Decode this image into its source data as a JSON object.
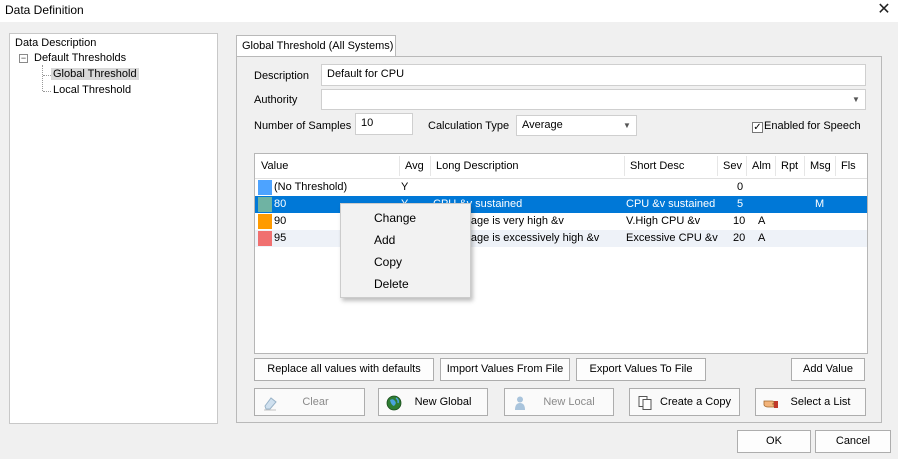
{
  "window": {
    "title": "Data Definition",
    "close_glyph": "✕"
  },
  "tree": {
    "root": "Data Description",
    "group": "Default Thresholds",
    "expander": "−",
    "items": [
      "Global Threshold",
      "Local Threshold"
    ]
  },
  "tab": {
    "label": "Global Threshold (All Systems)"
  },
  "form": {
    "description_label": "Description",
    "description_value": "Default for CPU",
    "authority_label": "Authority",
    "authority_value": "",
    "samples_label": "Number of Samples",
    "samples_value": "10",
    "calc_label": "Calculation Type",
    "calc_value": "Average",
    "speech_label": "Enabled for Speech",
    "speech_checked": true,
    "check_glyph": "✓",
    "dropdown_glyph": "▼"
  },
  "grid": {
    "columns": [
      "Value",
      "Avg",
      "Long Description",
      "Short Desc",
      "Sev",
      "Alm",
      "Rpt",
      "Msg",
      "Fls"
    ],
    "rows": [
      {
        "color": "#4da3ff",
        "value": "(No Threshold)",
        "avg": "Y",
        "long": "",
        "short": "",
        "sev": "0",
        "alm": "",
        "rpt": "",
        "msg": "",
        "fls": ""
      },
      {
        "color": "#6fb3a3",
        "value": "80",
        "avg": "Y",
        "long": "CPU &v sustained",
        "short": "CPU &v sustained",
        "sev": "5",
        "alm": "",
        "rpt": "",
        "msg": "M",
        "fls": ""
      },
      {
        "color": "#ff9b00",
        "value": "90",
        "avg": "Y",
        "long": "CPU usage is very high &v",
        "short": "V.High CPU &v",
        "sev": "10",
        "alm": "A",
        "rpt": "",
        "msg": "",
        "fls": ""
      },
      {
        "color": "#f07070",
        "value": "95",
        "avg": "Y",
        "long": "CPU usage is excessively high &v",
        "short": "Excessive CPU &v",
        "sev": "20",
        "alm": "A",
        "rpt": "",
        "msg": "",
        "fls": ""
      }
    ]
  },
  "context_menu": [
    "Change",
    "Add",
    "Copy",
    "Delete"
  ],
  "buttons_row1": {
    "replace": "Replace all values with defaults",
    "import": "Import Values From File",
    "export": "Export Values To File",
    "add": "Add Value"
  },
  "buttons_row2": {
    "clear": "Clear",
    "new_global": "New Global",
    "new_local": "New Local",
    "create_copy": "Create a Copy",
    "select_list": "Select a List"
  },
  "footer": {
    "ok": "OK",
    "cancel": "Cancel"
  },
  "colors": {
    "selection": "#0078d7",
    "alt_row": "#eef2f8"
  }
}
